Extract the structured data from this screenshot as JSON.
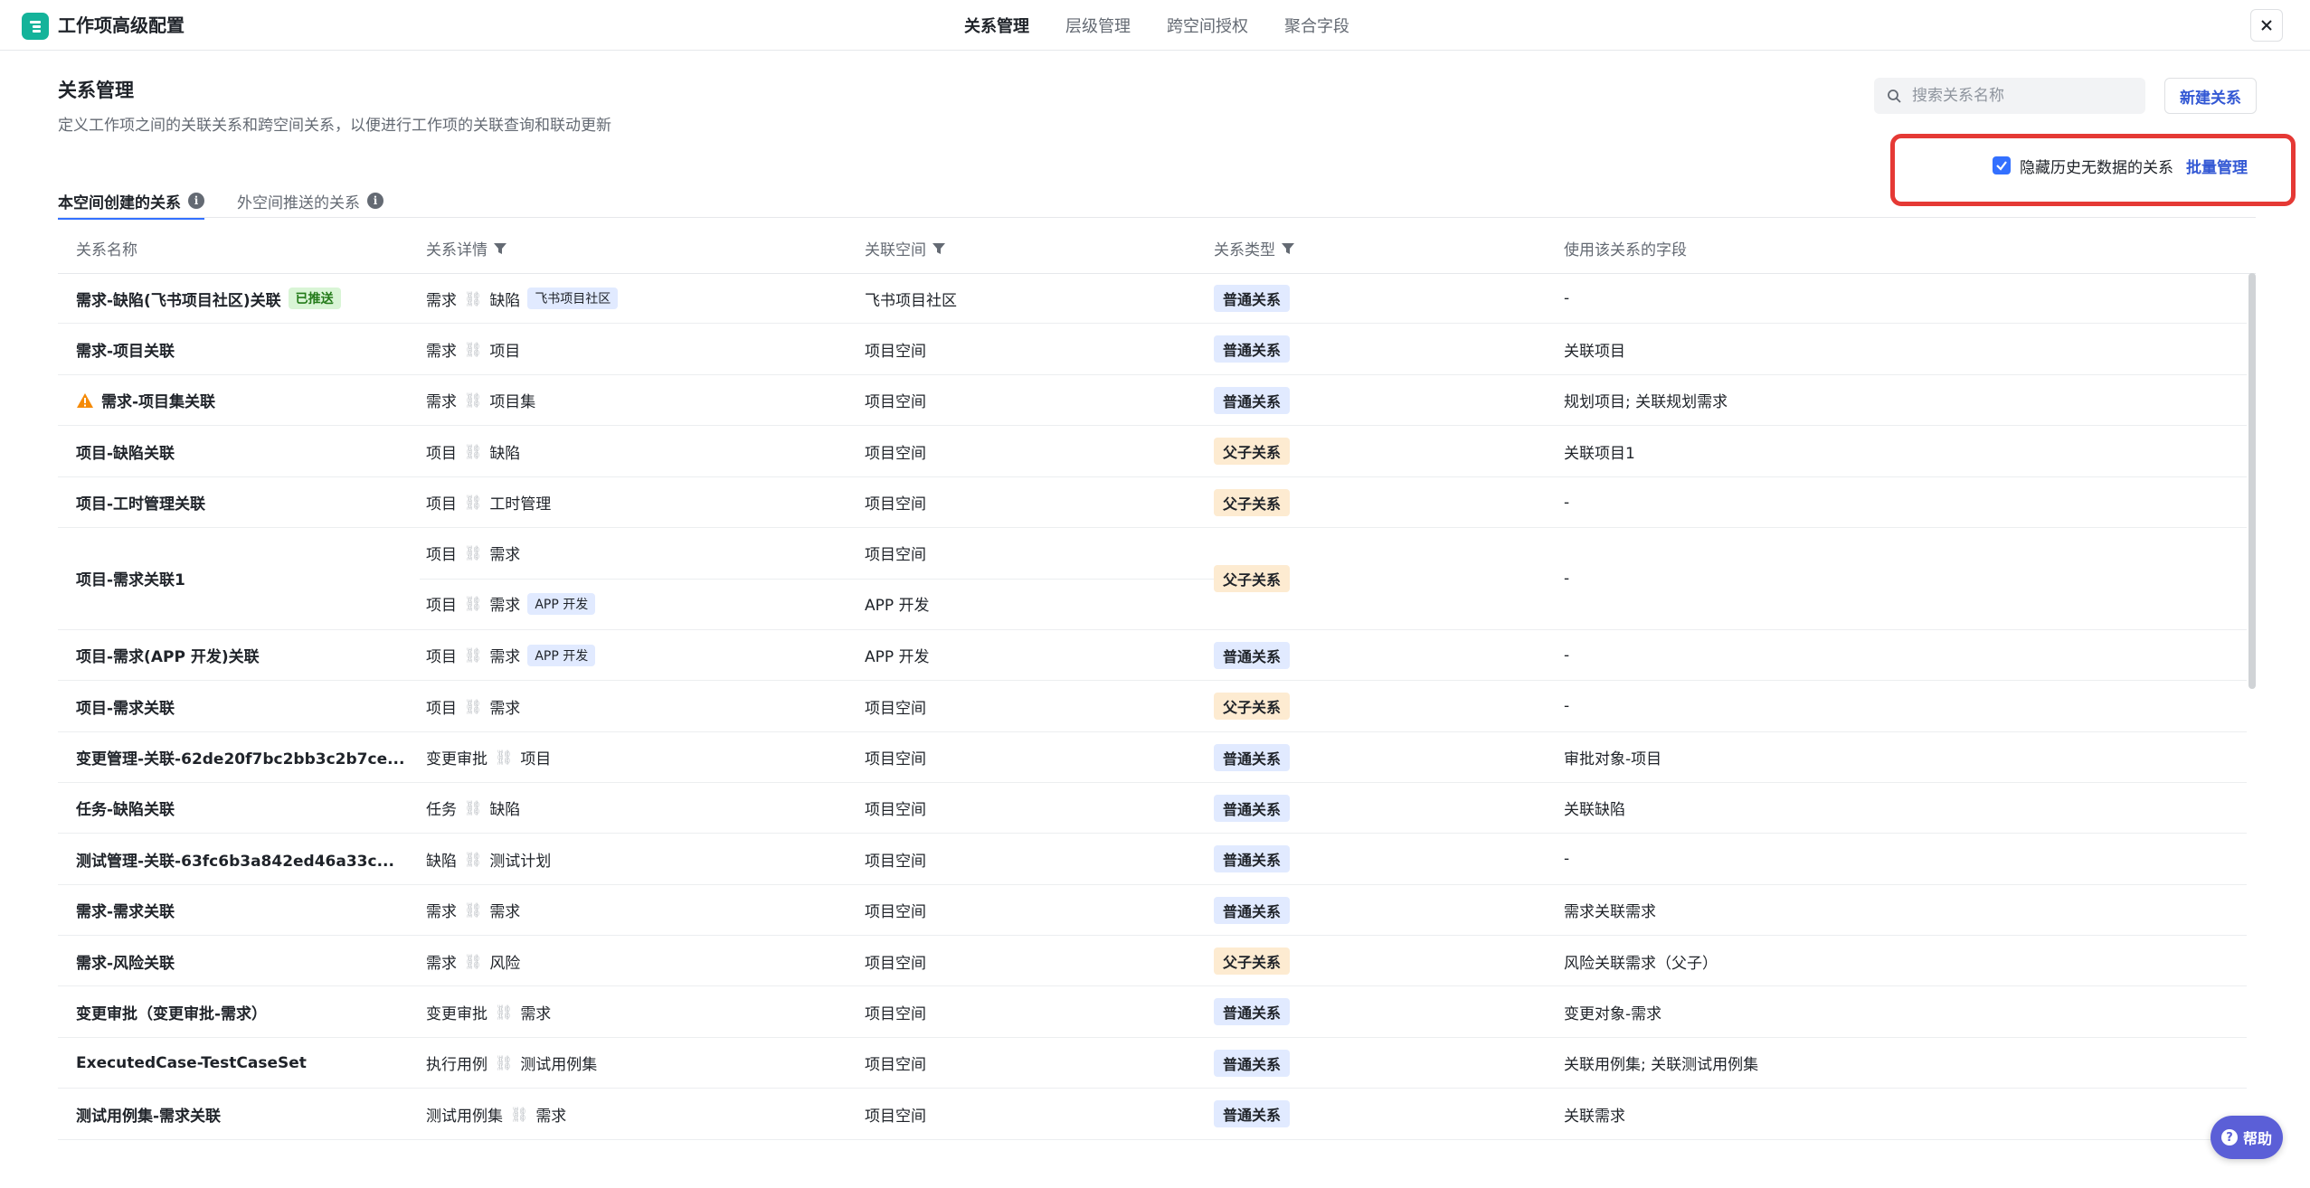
{
  "app": {
    "title": "工作项高级配置"
  },
  "nav": [
    {
      "label": "关系管理",
      "active": true
    },
    {
      "label": "层级管理",
      "active": false
    },
    {
      "label": "跨空间授权",
      "active": false
    },
    {
      "label": "聚合字段",
      "active": false
    }
  ],
  "header": {
    "title": "关系管理",
    "description": "定义工作项之间的关联关系和跨空间关系，以便进行工作项的关联查询和联动更新",
    "search_placeholder": "搜索关系名称",
    "new_button": "新建关系",
    "hide_checkbox_label": "隐藏历史无数据的关系",
    "hide_checkbox_checked": true,
    "batch_link": "批量管理"
  },
  "subtabs": [
    {
      "label": "本空间创建的关系",
      "active": true
    },
    {
      "label": "外空间推送的关系",
      "active": false
    }
  ],
  "columns": [
    "关系名称",
    "关系详情",
    "关联空间",
    "关系类型",
    "使用该关系的字段"
  ],
  "rows": [
    {
      "name": "需求-缺陷(飞书项目社区)关联",
      "tag": "已推送",
      "from": "需求",
      "to": "缺陷",
      "to_tag": "飞书项目社区",
      "space": "飞书项目社区",
      "type": "普通关系",
      "fields": "-"
    },
    {
      "name": "需求-项目关联",
      "from": "需求",
      "to": "项目",
      "space": "项目空间",
      "type": "普通关系",
      "fields": "关联项目"
    },
    {
      "name": "需求-项目集关联",
      "warning": true,
      "from": "需求",
      "to": "项目集",
      "space": "项目空间",
      "type": "普通关系",
      "fields": "规划项目; 关联规划需求"
    },
    {
      "name": "项目-缺陷关联",
      "from": "项目",
      "to": "缺陷",
      "space": "项目空间",
      "type": "父子关系",
      "fields": "关联项目1"
    },
    {
      "name": "项目-工时管理关联",
      "from": "项目",
      "to": "工时管理",
      "space": "项目空间",
      "type": "父子关系",
      "fields": "-"
    },
    {
      "name": "项目-需求关联1",
      "from": "项目",
      "to": "需求",
      "space": "项目空间",
      "from2": "项目",
      "to2": "需求",
      "to2_tag": "APP 开发",
      "space2": "APP 开发",
      "type": "父子关系",
      "fields": "-"
    },
    {
      "name": "项目-需求(APP 开发)关联",
      "from": "项目",
      "to": "需求",
      "to_tag": "APP 开发",
      "space": "APP 开发",
      "type": "普通关系",
      "fields": "-"
    },
    {
      "name": "项目-需求关联",
      "from": "项目",
      "to": "需求",
      "space": "项目空间",
      "type": "父子关系",
      "fields": "-"
    },
    {
      "name": "变更管理-关联-62de20f7bc2bb3c2b7ce...",
      "from": "变更审批",
      "to": "项目",
      "space": "项目空间",
      "type": "普通关系",
      "fields": "审批对象-项目"
    },
    {
      "name": "任务-缺陷关联",
      "from": "任务",
      "to": "缺陷",
      "space": "项目空间",
      "type": "普通关系",
      "fields": "关联缺陷"
    },
    {
      "name": "测试管理-关联-63fc6b3a842ed46a33c...",
      "from": "缺陷",
      "to": "测试计划",
      "space": "项目空间",
      "type": "普通关系",
      "fields": "-"
    },
    {
      "name": "需求-需求关联",
      "from": "需求",
      "to": "需求",
      "space": "项目空间",
      "type": "普通关系",
      "fields": "需求关联需求"
    },
    {
      "name": "需求-风险关联",
      "from": "需求",
      "to": "风险",
      "space": "项目空间",
      "type": "父子关系",
      "fields": "风险关联需求（父子）"
    },
    {
      "name": "变更审批（变更审批-需求）",
      "from": "变更审批",
      "to": "需求",
      "space": "项目空间",
      "type": "普通关系",
      "fields": "变更对象-需求"
    },
    {
      "name": "ExecutedCase-TestCaseSet",
      "from": "执行用例",
      "to": "测试用例集",
      "space": "项目空间",
      "type": "普通关系",
      "fields": "关联用例集; 关联测试用例集"
    },
    {
      "name": "测试用例集-需求关联",
      "from": "测试用例集",
      "to": "需求",
      "space": "项目空间",
      "type": "普通关系",
      "fields": "关联需求"
    }
  ],
  "help": {
    "label": "帮助"
  },
  "colors": {
    "accent": "#3370ff",
    "link": "#3358d4",
    "highlight": "#e53935",
    "brand": "#14b39a"
  }
}
